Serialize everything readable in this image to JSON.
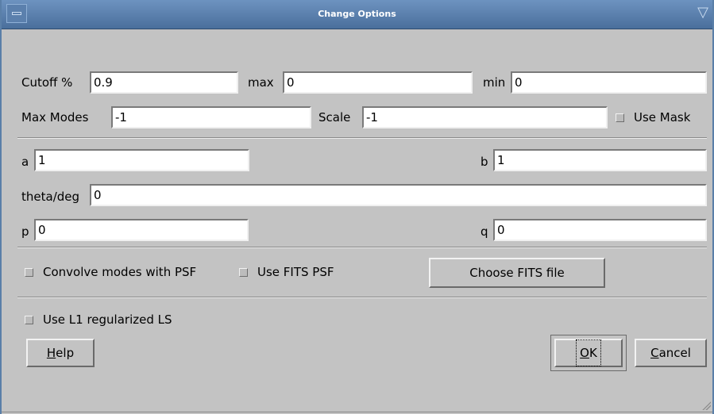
{
  "window": {
    "title": "Change Options"
  },
  "row1": {
    "cutoff_label": "Cutoff %",
    "cutoff_value": "0.9",
    "max_label": "max",
    "max_value": "0",
    "min_label": "min",
    "min_value": "0"
  },
  "row2": {
    "maxmodes_label": "Max Modes",
    "maxmodes_value": "-1",
    "scale_label": "Scale",
    "scale_value": "-1",
    "usemask_label": "Use Mask"
  },
  "shape": {
    "a_label": "a",
    "a_value": "1",
    "b_label": "b",
    "b_value": "1",
    "theta_label": "theta/deg",
    "theta_value": "0",
    "p_label": "p",
    "p_value": "0",
    "q_label": "q",
    "q_value": "0"
  },
  "psf": {
    "convolve_label": "Convolve modes with PSF",
    "usefits_label": "Use FITS PSF",
    "choose_label": "Choose FITS file"
  },
  "l1": {
    "label": "Use L1 regularized LS"
  },
  "buttons": {
    "help_mnemonic": "H",
    "help_rest": "elp",
    "ok_mnemonic": "O",
    "ok_rest": "K",
    "cancel_mnemonic": "C",
    "cancel_rest": "ancel"
  },
  "colors": {
    "titlebar": "#5a7fa8",
    "background": "#c3c3c3"
  }
}
